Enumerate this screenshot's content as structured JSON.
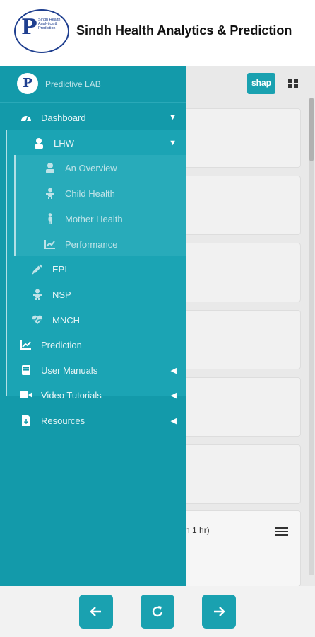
{
  "header": {
    "title": "Sindh Health Analytics & Prediction",
    "logo_text": "Sindh Health Analytics & Prediction",
    "logo_letter": "P"
  },
  "sidebar": {
    "brand_label": "Predictive LAB",
    "items": {
      "dashboard": "Dashboard",
      "lhw": "LHW",
      "overview": "An Overview",
      "child_health": "Child Health",
      "mother_health": "Mother Health",
      "performance": "Performance",
      "epi": "EPI",
      "nsp": "NSP",
      "mnch": "MNCH",
      "prediction": "Prediction",
      "user_manuals": "User Manuals",
      "video_tutorials": "Video Tutorials",
      "resources": "Resources"
    }
  },
  "main": {
    "shap_label": "shap",
    "partial_text": "n 1 hr)"
  },
  "icons": {
    "dashboard": "gauge-icon",
    "lhw": "user-nurse-icon",
    "overview": "user-icon",
    "child": "baby-icon",
    "mother": "person-icon",
    "performance": "chart-line-icon",
    "epi": "syringe-icon",
    "nsp": "baby-icon",
    "mnch": "heartbeat-icon",
    "prediction": "chart-line-icon",
    "manuals": "book-icon",
    "video": "video-icon",
    "resources": "file-download-icon"
  },
  "colors": {
    "accent": "#139aaa",
    "button": "#1aa1b0"
  }
}
